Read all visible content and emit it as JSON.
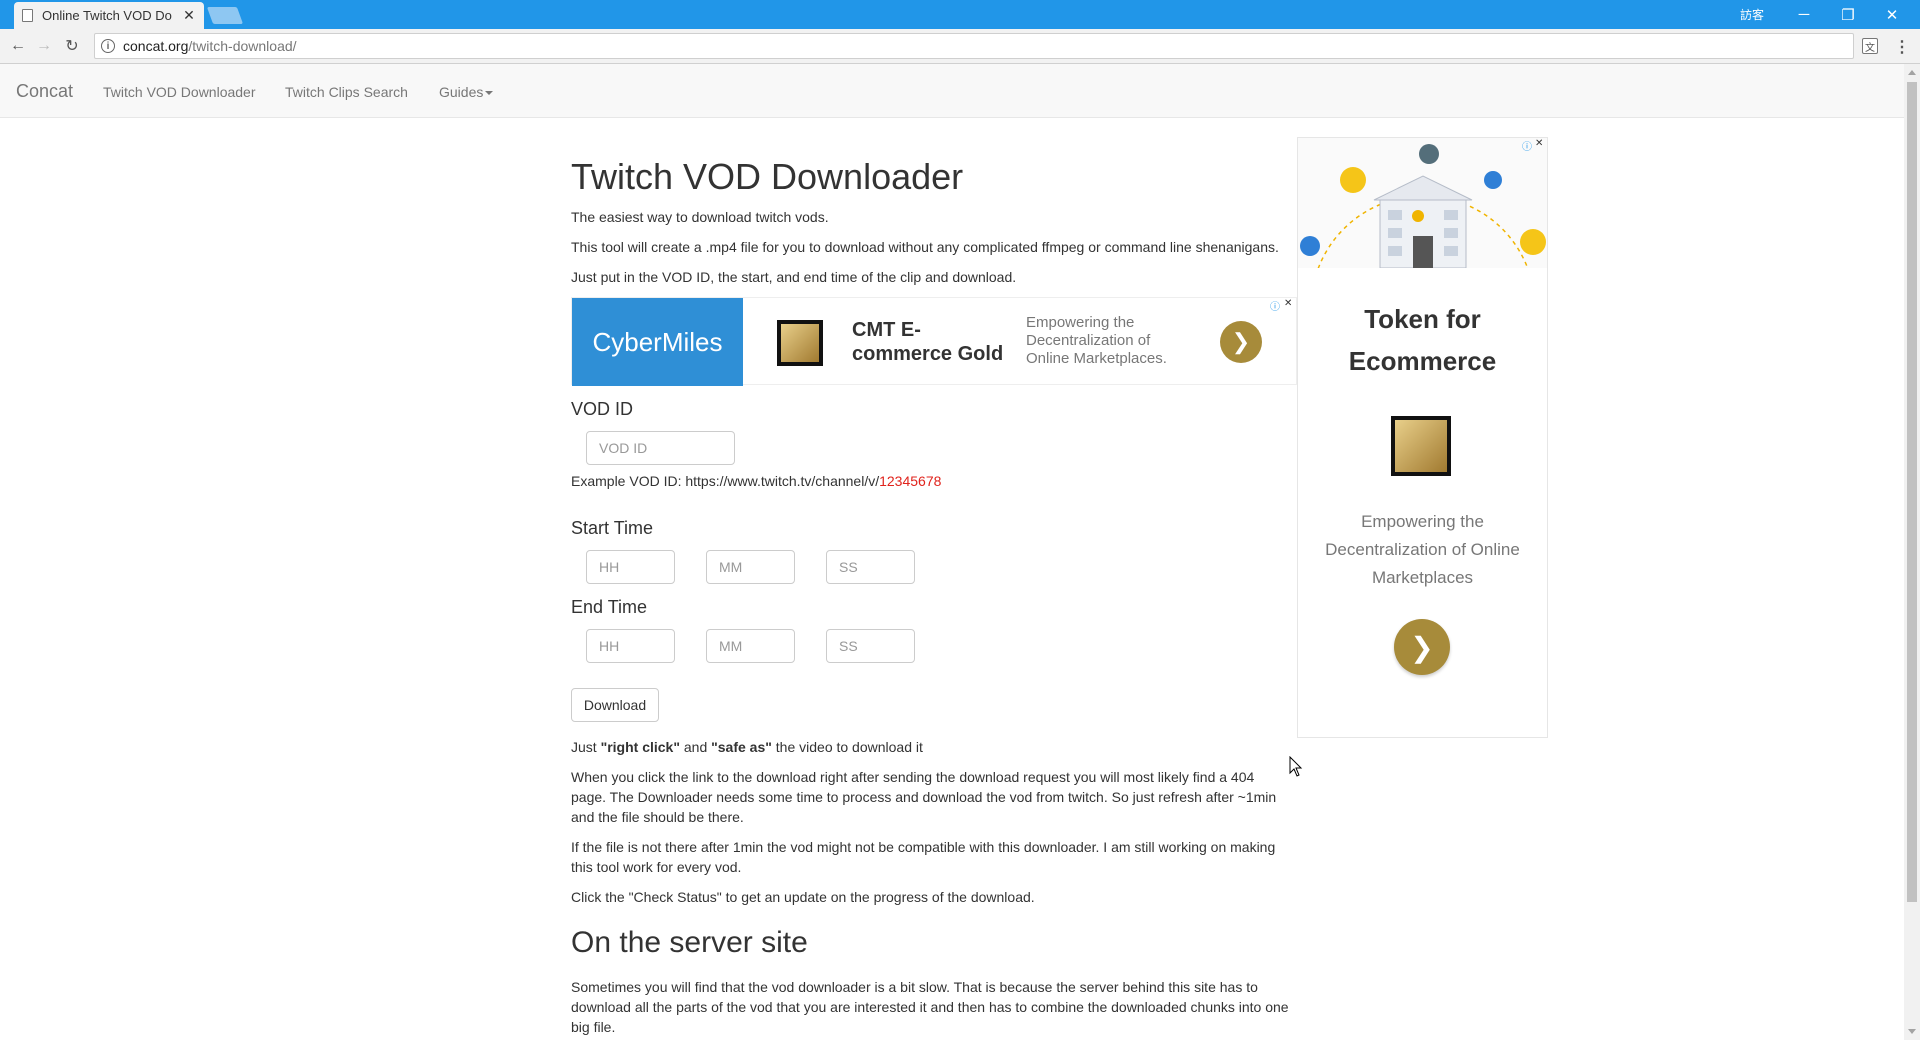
{
  "browser": {
    "tab_title": "Online Twitch VOD Do",
    "user_label": "訪客",
    "url_host": "concat.org",
    "url_path": "/twitch-download/"
  },
  "navbar": {
    "brand": "Concat",
    "links": [
      "Twitch VOD Downloader",
      "Twitch Clips Search",
      "Guides"
    ]
  },
  "main": {
    "title": "Twitch VOD Downloader",
    "intro": [
      "The easiest way to download twitch vods.",
      "This tool will create a .mp4 file for you to download without any complicated ffmpeg or command line shenanigans.",
      "Just put in the VOD ID, the start, and end time of the clip and download."
    ],
    "ad": {
      "brand": "CyberMiles",
      "headline": "CMT E-commerce Gold",
      "description": "Empowering the Decentralization of Online Marketplaces."
    },
    "vod_label": "VOD ID",
    "vod_placeholder": "VOD ID",
    "example_prefix": "Example VOD ID: https://www.twitch.tv/channel/v/",
    "example_id": "12345678",
    "start_label": "Start Time",
    "end_label": "End Time",
    "hh_placeholder": "HH",
    "mm_placeholder": "MM",
    "ss_placeholder": "SS",
    "download_button": "Download",
    "tip_just": "Just",
    "tip_right_click": "\"right click\"",
    "tip_and": "and",
    "tip_save_as": "\"safe as\"",
    "tip_rest": "the video to download it",
    "paragraphs": [
      "When you click the link to the download right after sending the download request you will most likely find a 404 page. The Downloader needs some time to process and download the vod from twitch. So just refresh after ~1min and the file should be there.",
      "If the file is not there after 1min the vod might not be compatible with this downloader. I am still working on making this tool work for every vod.",
      "Click the \"Check Status\" to get an update on the progress of the download."
    ],
    "section_title": "On the server site",
    "section_text": "Sometimes you will find that the vod downloader is a bit slow. That is because the server behind this site has to download all the parts of the vod that you are interested it and then has to combine the downloaded chunks into one big file."
  },
  "side_ad": {
    "title": "Token for Ecommerce",
    "description": "Empowering the Decentralization of Online Marketplaces"
  },
  "colors": {
    "chrome_blue": "#2196e8",
    "link_red": "#e0231c",
    "ad_gold": "#a78b3a"
  }
}
